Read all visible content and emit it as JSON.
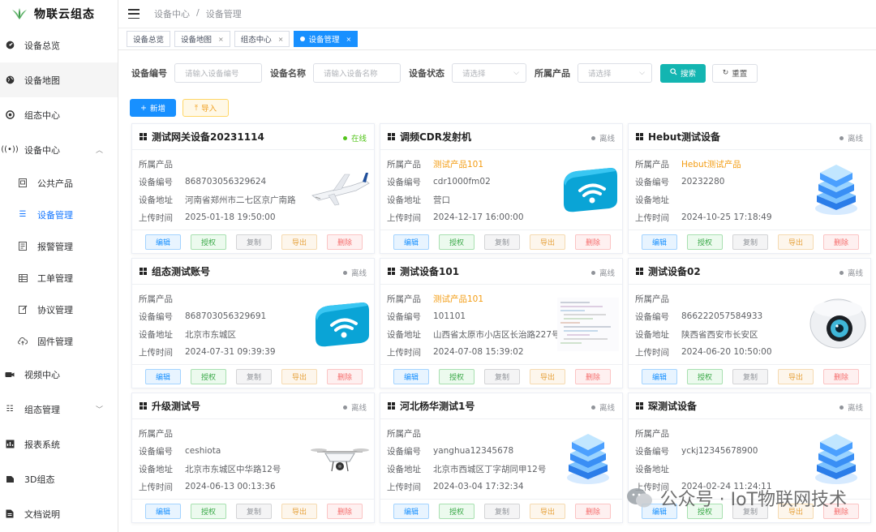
{
  "app": {
    "title": "物联云组态"
  },
  "sidebar": {
    "items": [
      {
        "label": "设备总览",
        "icon": "dashboard-icon"
      },
      {
        "label": "设备地图",
        "icon": "globe-icon"
      },
      {
        "label": "组态中心",
        "icon": "aperture-icon"
      },
      {
        "label": "设备中心",
        "icon": "broadcast-icon"
      },
      {
        "label": "视频中心",
        "icon": "camera-icon"
      },
      {
        "label": "组态管理",
        "icon": "list-icon"
      },
      {
        "label": "报表系统",
        "icon": "report-icon"
      },
      {
        "label": "3D组态",
        "icon": "cube-icon"
      },
      {
        "label": "文档说明",
        "icon": "document-icon"
      }
    ],
    "sub_items": [
      {
        "label": "公共产品",
        "icon": "box-icon"
      },
      {
        "label": "设备管理",
        "icon": "list-icon"
      },
      {
        "label": "报警管理",
        "icon": "alarm-icon"
      },
      {
        "label": "工单管理",
        "icon": "table-icon"
      },
      {
        "label": "协议管理",
        "icon": "edit-icon"
      },
      {
        "label": "固件管理",
        "icon": "cloud-upload-icon"
      }
    ]
  },
  "breadcrumb": {
    "parent": "设备中心",
    "separator": "/",
    "current": "设备管理"
  },
  "tabs": [
    {
      "label": "设备总览"
    },
    {
      "label": "设备地图",
      "close": "×"
    },
    {
      "label": "组态中心",
      "close": "×"
    },
    {
      "label": "设备管理",
      "close": "×"
    }
  ],
  "filters": {
    "device_no": {
      "label": "设备编号",
      "placeholder": "请输入设备编号"
    },
    "device_name": {
      "label": "设备名称",
      "placeholder": "请输入设备名称"
    },
    "device_status": {
      "label": "设备状态",
      "placeholder": "请选择"
    },
    "product": {
      "label": "所属产品",
      "placeholder": "请选择"
    },
    "search_label": "搜索",
    "reset_label": "重置"
  },
  "actions": {
    "add_label": "新增",
    "import_label": "导入"
  },
  "field_labels": {
    "product": "所属产品",
    "device_no": "设备编号",
    "address": "设备地址",
    "upload_time": "上传时间"
  },
  "card_buttons": {
    "edit": "编辑",
    "auth": "授权",
    "copy": "复制",
    "export": "导出",
    "delete": "删除"
  },
  "colors": {
    "primary": "#1890ff",
    "teal": "#13b5b1",
    "online": "#52c41a",
    "offline": "#909399",
    "product": "#f39c12"
  },
  "devices": [
    {
      "name": "测试网关设备20231114",
      "status": "在线",
      "online": true,
      "product": "",
      "device_no": "868703056329624",
      "address": "河南省郑州市二七区京广南路",
      "upload_time": "2025-01-18 19:50:00",
      "image": "airplane"
    },
    {
      "name": "调频CDR发射机",
      "status": "离线",
      "online": false,
      "product": "测试产品101",
      "device_no": "cdr1000fm02",
      "address": "营口",
      "upload_time": "2024-12-17 16:00:00",
      "image": "wifi"
    },
    {
      "name": "Hebut测试设备",
      "status": "离线",
      "online": false,
      "product": "Hebut测试产品",
      "device_no": "20232280",
      "address": "",
      "upload_time": "2024-10-25 17:18:49",
      "image": "server"
    },
    {
      "name": "组态测试账号",
      "status": "离线",
      "online": false,
      "product": "",
      "device_no": "868703056329691",
      "address": "北京市东城区",
      "upload_time": "2024-07-31 09:39:39",
      "image": "wifi"
    },
    {
      "name": "测试设备101",
      "status": "离线",
      "online": false,
      "product": "测试产品101",
      "device_no": "101101",
      "address": "山西省太原市小店区长治路227号",
      "upload_time": "2024-07-08 15:39:02",
      "image": "code"
    },
    {
      "name": "测试设备02",
      "status": "离线",
      "online": false,
      "product": "",
      "device_no": "866222057584933",
      "address": "陕西省西安市长安区",
      "upload_time": "2024-06-20 10:50:00",
      "image": "camera"
    },
    {
      "name": "升级测试号",
      "status": "离线",
      "online": false,
      "product": "",
      "device_no": "ceshiota",
      "address": "北京市东城区中华路12号",
      "upload_time": "2024-06-13 00:13:36",
      "image": "drone"
    },
    {
      "name": "河北杨华测试1号",
      "status": "离线",
      "online": false,
      "product": "",
      "device_no": "yanghua12345678",
      "address": "北京市西城区丁字胡同甲12号",
      "upload_time": "2024-03-04 17:32:34",
      "image": "server"
    },
    {
      "name": "琛测试设备",
      "status": "离线",
      "online": false,
      "product": "",
      "device_no": "yckj12345678900",
      "address": "",
      "upload_time": "2024-02-24 11:24:11",
      "image": "server"
    }
  ],
  "watermark": {
    "text": "公众号 · IoT物联网技术"
  }
}
